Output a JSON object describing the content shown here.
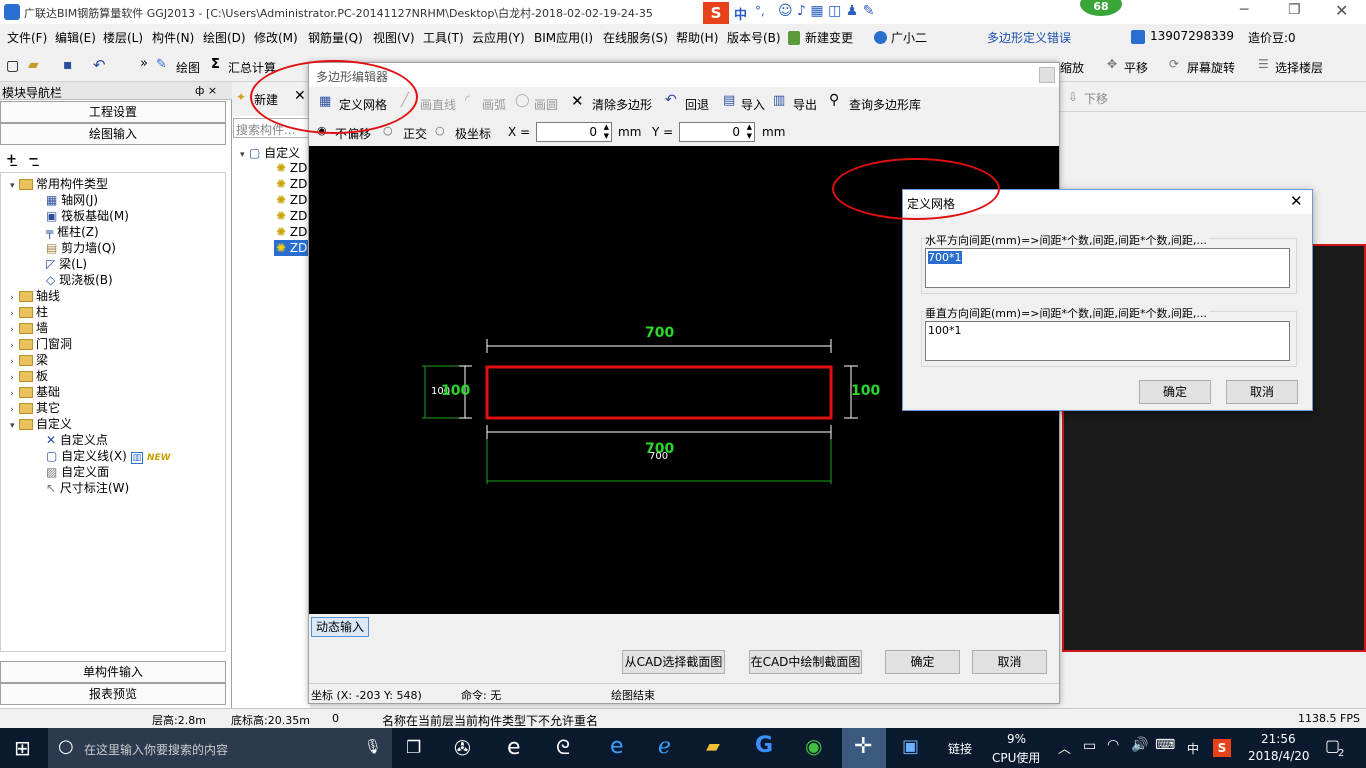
{
  "titlebar": {
    "title": "广联达BIM钢筋算量软件 GGJ2013 - [C:\\Users\\Administrator.PC-20141127NRHM\\Desktop\\白龙村-2018-02-02-19-24-35",
    "ime_labels": [
      "中",
      "°,"
    ],
    "badge": "68"
  },
  "menubar": {
    "items": [
      "文件(F)",
      "编辑(E)",
      "楼层(L)",
      "构件(N)",
      "绘图(D)",
      "修改(M)",
      "钢筋量(Q)",
      "视图(V)",
      "工具(T)",
      "云应用(Y)",
      "BIM应用(I)",
      "在线服务(S)",
      "帮助(H)",
      "版本号(B)",
      "新建变更",
      "广小二"
    ],
    "error_text": "多边形定义错误",
    "phone": "13907298339",
    "price": "造价豆:0"
  },
  "toolbar": {
    "draw": "绘图",
    "sum": "汇总计算",
    "right_items": [
      "缩放",
      "平移",
      "屏幕旋转",
      "选择楼层"
    ],
    "move_down": "下移"
  },
  "nav": {
    "title": "模块导航栏",
    "pin": "ф ×",
    "project_settings": "工程设置",
    "drawing_input": "绘图输入",
    "single_input": "单构件输入",
    "report": "报表预览",
    "tree_common": "常用构件类型",
    "common_items": [
      "轴网(J)",
      "筏板基础(M)",
      "框柱(Z)",
      "剪力墙(Q)",
      "梁(L)",
      "现浇板(B)"
    ],
    "groups": [
      "轴线",
      "柱",
      "墙",
      "门窗洞",
      "梁",
      "板",
      "基础",
      "其它"
    ],
    "custom": "自定义",
    "custom_items": [
      "自定义点",
      "自定义线(X)",
      "自定义面",
      "尺寸标注(W)"
    ],
    "new_badge": "NEW"
  },
  "list2": {
    "new_btn": "新建",
    "search": "搜索构件...",
    "root": "自定义",
    "items": [
      "ZD",
      "ZD",
      "ZD",
      "ZD",
      "ZD",
      "ZD"
    ]
  },
  "poly": {
    "title": "多边形编辑器",
    "tools": [
      "定义网格",
      "画直线",
      "画弧",
      "画圆",
      "清除多边形",
      "回退",
      "导入",
      "导出",
      "查询多边形库"
    ],
    "modes": [
      "不偏移",
      "正交",
      "极坐标"
    ],
    "x_label": "X =",
    "x_value": "0",
    "y_label": "Y =",
    "y_value": "0",
    "unit": "mm",
    "dim_top": "700",
    "dim_bottom": "700",
    "dim_bottom_small": "700",
    "dim_left": "100",
    "dim_left_small": "100",
    "dim_right": "100",
    "dynamic_input": "动态输入",
    "btn_select_cad": "从CAD选择截面图",
    "btn_draw_cad": "在CAD中绘制截面图",
    "btn_ok": "确定",
    "btn_cancel": "取消",
    "coords": "坐标 (X: -203 Y: 548)",
    "command": "命令: 无",
    "draw_end": "绘图结束"
  },
  "grid": {
    "title": "定义网格",
    "h_label": "水平方向间距(mm)=>间距*个数,间距,间距*个数,间距,...",
    "h_value": "700*1",
    "v_label": "垂直方向间距(mm)=>间距*个数,间距,间距*个数,间距,...",
    "v_value": "100*1",
    "ok": "确定",
    "cancel": "取消"
  },
  "statusbar": {
    "floor_height": "层高:2.8m",
    "bottom_height": "底标高:20.35m",
    "zero": "0",
    "message": "名称在当前层当前构件类型下不允许重名",
    "fps": "1138.5 FPS"
  },
  "taskbar": {
    "search": "在这里输入你要搜索的内容",
    "link": "链接",
    "cpu_pct": "9%",
    "cpu_label": "CPU使用",
    "lang": "中",
    "time": "21:56",
    "date": "2018/4/20",
    "notify": "2"
  }
}
